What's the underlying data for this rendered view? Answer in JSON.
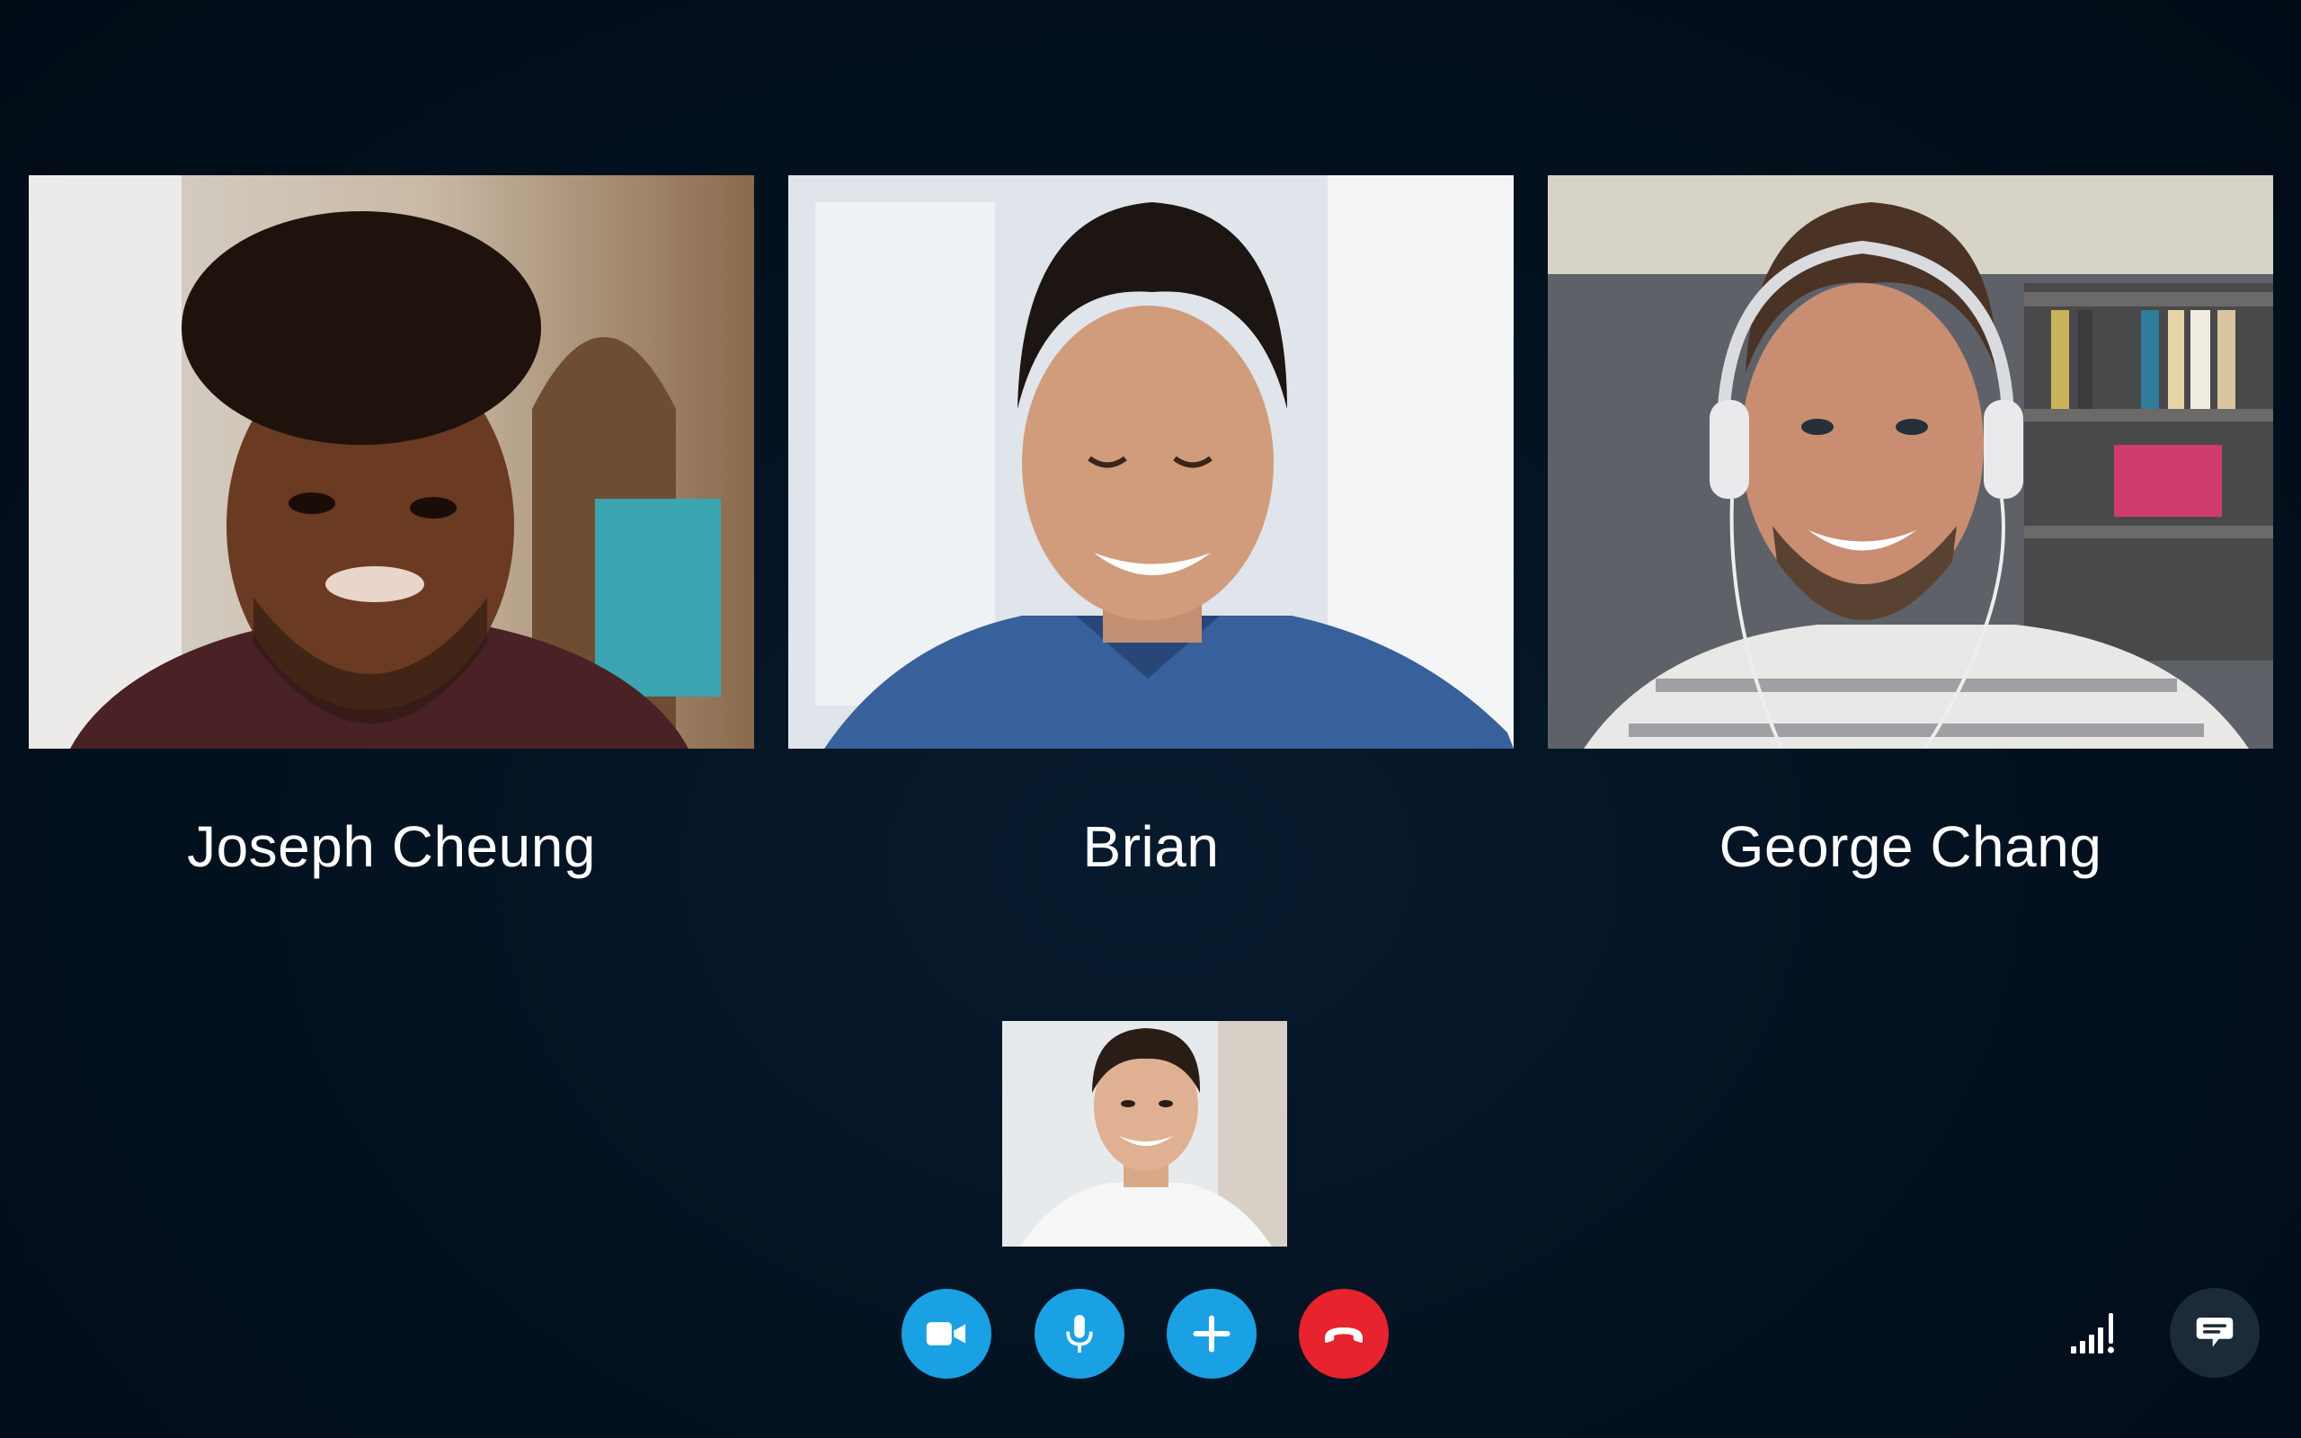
{
  "call": {
    "participants": [
      {
        "name": "Joseph Cheung"
      },
      {
        "name": "Brian"
      },
      {
        "name": "George Chang"
      }
    ]
  },
  "controls": {
    "video_icon": "video-camera-icon",
    "mic_icon": "microphone-icon",
    "add_icon": "plus-icon",
    "end_icon": "phone-hangup-icon",
    "signal_icon": "signal-weak-icon",
    "chat_icon": "chat-bubble-icon"
  },
  "colors": {
    "background": "#03111f",
    "control_blue": "#1aa1e3",
    "end_call_red": "#e6232e",
    "chat_button_bg": "#1c2b38",
    "name_text": "#ffffff"
  }
}
